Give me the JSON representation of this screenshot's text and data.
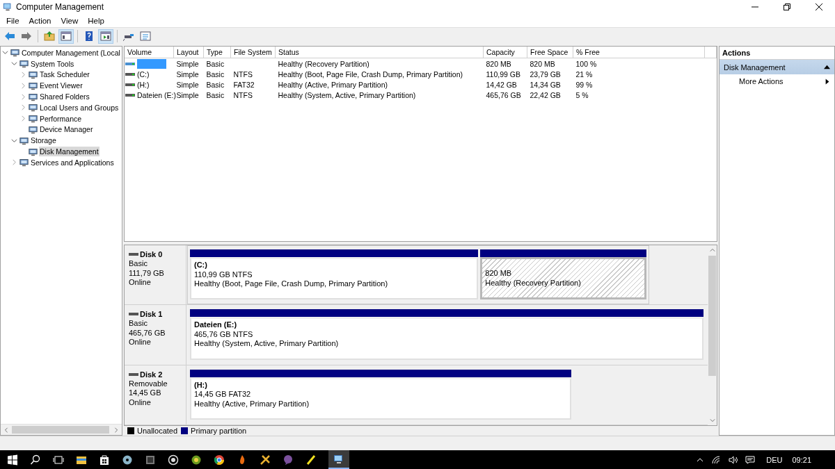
{
  "window": {
    "title": "Computer Management"
  },
  "menu": [
    "File",
    "Action",
    "View",
    "Help"
  ],
  "toolbar": [
    {
      "kind": "back",
      "pressed": false
    },
    {
      "kind": "forward",
      "pressed": false
    },
    {
      "kind": "up",
      "pressed": false
    },
    {
      "kind": "tree",
      "pressed": true
    },
    {
      "kind": "help",
      "pressed": false
    },
    {
      "kind": "pane",
      "pressed": true
    },
    {
      "kind": "connect",
      "pressed": false
    },
    {
      "kind": "list",
      "pressed": false
    }
  ],
  "tree": [
    {
      "label": "Computer Management (Local",
      "expanded": true,
      "selected": false,
      "children": [
        {
          "label": "System Tools",
          "expanded": true,
          "selected": false,
          "children": [
            {
              "label": "Task Scheduler",
              "expanded": false,
              "selected": false
            },
            {
              "label": "Event Viewer",
              "expanded": false,
              "selected": false
            },
            {
              "label": "Shared Folders",
              "expanded": false,
              "selected": false
            },
            {
              "label": "Local Users and Groups",
              "expanded": false,
              "selected": false
            },
            {
              "label": "Performance",
              "expanded": false,
              "selected": false
            },
            {
              "label": "Device Manager",
              "selected": false
            }
          ]
        },
        {
          "label": "Storage",
          "expanded": true,
          "selected": false,
          "children": [
            {
              "label": "Disk Management",
              "selected": true
            }
          ]
        },
        {
          "label": "Services and Applications",
          "expanded": false,
          "selected": false
        }
      ]
    }
  ],
  "table": {
    "columns": [
      "Volume",
      "Layout",
      "Type",
      "File System",
      "Status",
      "Capacity",
      "Free Space",
      "% Free"
    ],
    "rows": [
      {
        "selected": true,
        "cells": [
          "",
          "Simple",
          "Basic",
          "",
          "Healthy (Recovery Partition)",
          "820 MB",
          "820 MB",
          "100 %"
        ]
      },
      {
        "selected": false,
        "cells": [
          "(C:)",
          "Simple",
          "Basic",
          "NTFS",
          "Healthy (Boot, Page File, Crash Dump, Primary Partition)",
          "110,99 GB",
          "23,79 GB",
          "21 %"
        ]
      },
      {
        "selected": false,
        "cells": [
          "(H:)",
          "Simple",
          "Basic",
          "FAT32",
          "Healthy (Active, Primary Partition)",
          "14,42 GB",
          "14,34 GB",
          "99 %"
        ]
      },
      {
        "selected": false,
        "cells": [
          "Dateien (E:)",
          "Simple",
          "Basic",
          "NTFS",
          "Healthy (System, Active, Primary Partition)",
          "465,76 GB",
          "22,42 GB",
          "5 %"
        ]
      }
    ]
  },
  "disks": [
    {
      "name": "Disk 0",
      "type": "Basic",
      "size": "111,79 GB",
      "state": "Online",
      "partitions": [
        {
          "name": "(C:)",
          "size": "110,99 GB NTFS",
          "status": "Healthy (Boot, Page File, Crash Dump, Primary Partition)",
          "selected": false
        },
        {
          "size": "820 MB",
          "status": "Healthy (Recovery Partition)",
          "selected": true
        }
      ]
    },
    {
      "name": "Disk 1",
      "type": "Basic",
      "size": "465,76 GB",
      "state": "Online",
      "partitions": [
        {
          "name": "Dateien  (E:)",
          "size": "465,76 GB NTFS",
          "status": "Healthy (System, Active, Primary Partition)",
          "selected": false
        }
      ]
    },
    {
      "name": "Disk 2",
      "type": "Removable",
      "size": "14,45 GB",
      "state": "Online",
      "partitions": [
        {
          "name": "(H:)",
          "size": "14,45 GB FAT32",
          "status": "Healthy (Active, Primary Partition)",
          "selected": false
        }
      ]
    }
  ],
  "legend": [
    {
      "label": "Unallocated",
      "color": "#000000"
    },
    {
      "label": "Primary partition",
      "color": "#000080"
    }
  ],
  "actions": {
    "title": "Actions",
    "section": "Disk Management",
    "items": [
      "More Actions"
    ]
  },
  "taskbar": {
    "language": "DEU",
    "time": "09:21"
  }
}
